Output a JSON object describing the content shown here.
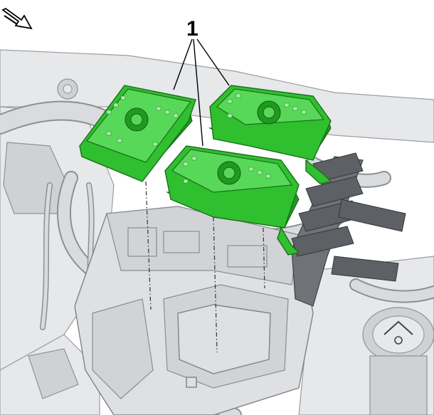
{
  "diagram": {
    "callouts": [
      {
        "label": "1"
      }
    ],
    "icons": {
      "direction_arrow": "direction-arrow-icon",
      "reservoir_cap_symbol": "reservoir-cap-icon"
    },
    "colors": {
      "highlight": "#2fbf2f",
      "highlight_dark": "#1b6e1b",
      "line_art": "#8c8f94",
      "background": "#ffffff"
    }
  }
}
